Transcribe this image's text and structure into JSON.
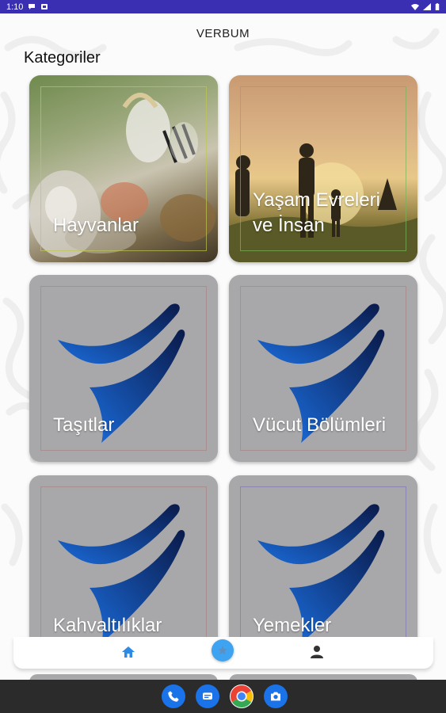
{
  "status_bar": {
    "time": "1:10",
    "icons": [
      "message-icon",
      "notification-icon",
      "wifi-icon",
      "signal-icon",
      "battery-icon"
    ]
  },
  "header": {
    "app_title": "VERBUM",
    "section_title": "Kategoriler"
  },
  "categories": [
    {
      "label": "Hayvanlar",
      "image": "animals-photo"
    },
    {
      "label": "Yaşam Evreleri ve İnsan",
      "image": "family-sunset-photo"
    },
    {
      "label": "Taşıtlar",
      "image": "app-logo"
    },
    {
      "label": "Vücut Bölümleri",
      "image": "app-logo"
    },
    {
      "label": "Kahvaltılıklar",
      "image": "app-logo"
    },
    {
      "label": "Yemekler",
      "image": "app-logo"
    }
  ],
  "bottom_nav": {
    "items": [
      "home-icon",
      "star-icon",
      "person-icon"
    ],
    "active": "home-icon"
  },
  "dock": {
    "apps": [
      "phone-icon",
      "messages-icon",
      "chrome-icon",
      "camera-icon"
    ]
  },
  "colors": {
    "status_bar": "#3a2eb3",
    "accent": "#3ea3f0",
    "logo_blue": "#1a57c8",
    "card_gray": "#a8a8aa"
  }
}
